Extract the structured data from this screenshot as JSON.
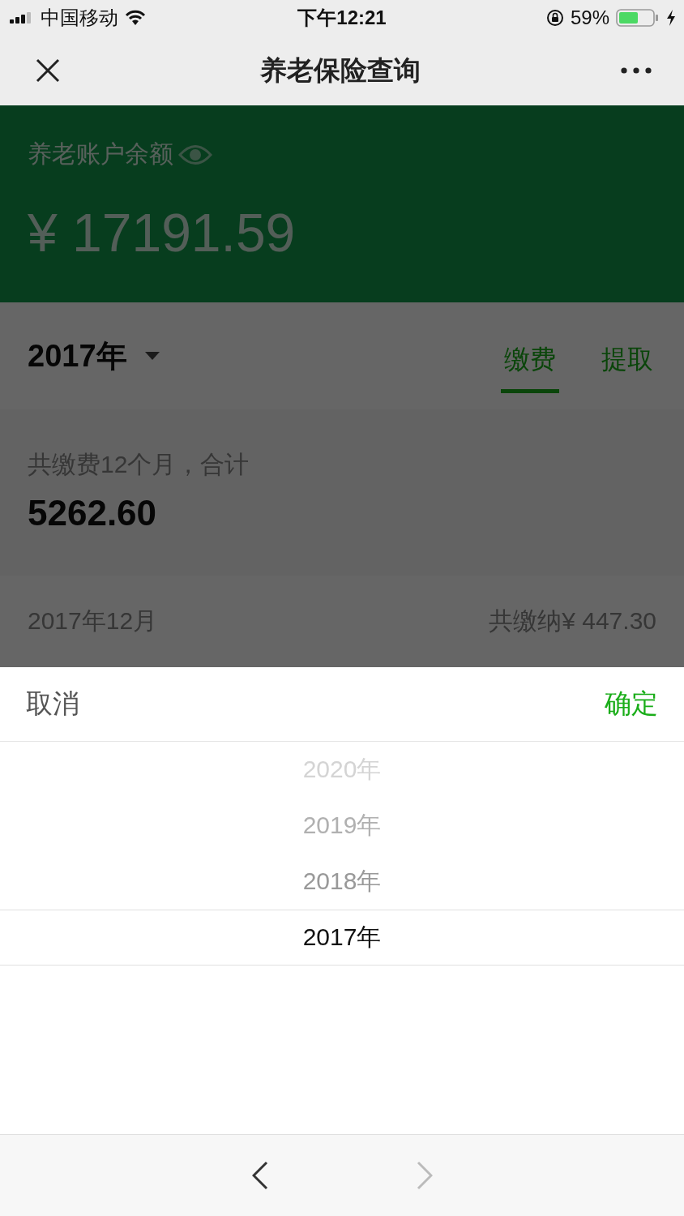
{
  "status_bar": {
    "carrier": "中国移动",
    "time": "下午12:21",
    "battery": "59%"
  },
  "nav": {
    "title": "养老保险查询"
  },
  "balance": {
    "label": "养老账户余额",
    "amount": "¥ 17191.59"
  },
  "year_selector": {
    "value": "2017年"
  },
  "tabs": [
    {
      "label": "缴费",
      "selected": true
    },
    {
      "label": "提取",
      "selected": false
    }
  ],
  "summary": {
    "label": "共缴费12个月，合计",
    "total": "5262.60"
  },
  "records": [
    {
      "month": "2017年12月",
      "amount": "共缴纳¥ 447.30"
    }
  ],
  "picker": {
    "cancel": "取消",
    "confirm": "确定",
    "options": [
      {
        "label": "2020年",
        "selected": false
      },
      {
        "label": "2019年",
        "selected": false
      },
      {
        "label": "2018年",
        "selected": false
      },
      {
        "label": "2017年",
        "selected": true
      }
    ]
  },
  "toolbar": {
    "back_disabled": false,
    "forward_disabled": true
  }
}
